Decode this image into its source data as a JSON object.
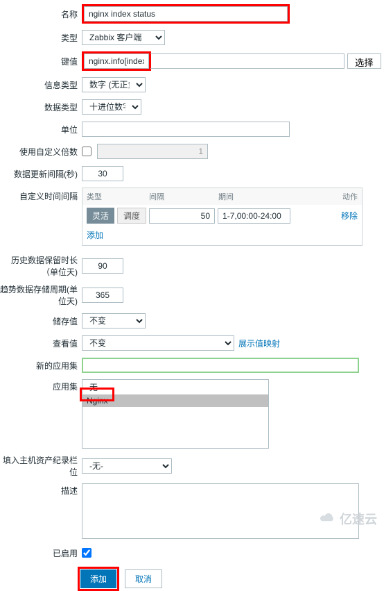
{
  "labels": {
    "name": "名称",
    "type": "类型",
    "key": "键值",
    "info_type": "信息类型",
    "data_type": "数据类型",
    "unit": "单位",
    "custom_mul": "使用自定义倍数",
    "update_interval": "数据更新间隔(秒)",
    "custom_intervals": "自定义时间间隔",
    "history": "历史数据保留时长（单位天)",
    "trends": "趋势数据存储周期(单位天)",
    "store_value": "储存值",
    "show_value": "查看值",
    "new_app": "新的应用集",
    "apps": "应用集",
    "inventory": "填入主机资产纪录栏位",
    "description": "描述",
    "enabled": "已启用"
  },
  "values": {
    "name": "nginx index status",
    "type": "Zabbix 客户端",
    "key": "nginx.info[index]",
    "info_type": "数字 (无正负)",
    "data_type": "十进位数字",
    "unit": "",
    "custom_mul_val": "1",
    "update_interval": "30",
    "history": "90",
    "trends": "365",
    "store_value": "不变",
    "show_value": "不变",
    "new_app": "",
    "inventory": "-无-"
  },
  "buttons": {
    "select": "选择",
    "add": "添加",
    "cancel": "取消",
    "add_interval": "添加",
    "remove": "移除",
    "show_value_map": "展示值映射",
    "flexible": "灵活",
    "scheduling": "调度"
  },
  "interval_headers": {
    "type": "类型",
    "interval": "间隔",
    "period": "期间",
    "action": "动作"
  },
  "interval_row": {
    "interval": "50",
    "period": "1-7,00:00-24:00"
  },
  "app_options": {
    "none": "-无-",
    "nginx": "Nginx"
  },
  "watermark": "亿速云"
}
